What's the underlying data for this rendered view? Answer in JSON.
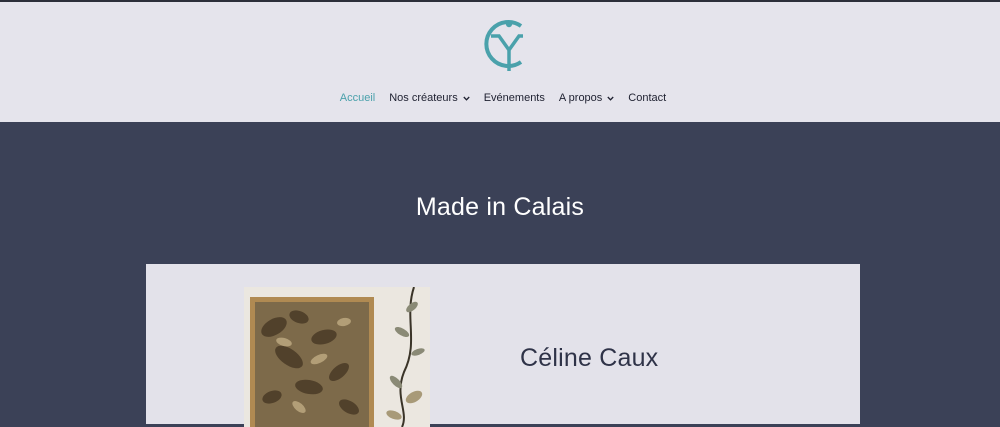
{
  "header": {
    "logo_icon": "mc-monogram-logo",
    "nav": [
      {
        "label": "Accueil",
        "active": true,
        "has_dropdown": false
      },
      {
        "label": "Nos créateurs",
        "active": false,
        "has_dropdown": true
      },
      {
        "label": "Evénements",
        "active": false,
        "has_dropdown": false
      },
      {
        "label": "A propos",
        "active": false,
        "has_dropdown": true
      },
      {
        "label": "Contact",
        "active": false,
        "has_dropdown": false
      }
    ]
  },
  "hero": {
    "title": "Made in Calais"
  },
  "featured_creator": {
    "name": "Céline Caux",
    "image_icon": "framed-botanical-artwork"
  },
  "colors": {
    "accent": "#4aa1ab",
    "header_bg": "#e5e4ec",
    "page_bg": "#3b4157",
    "card_bg": "#e3e2ea"
  }
}
